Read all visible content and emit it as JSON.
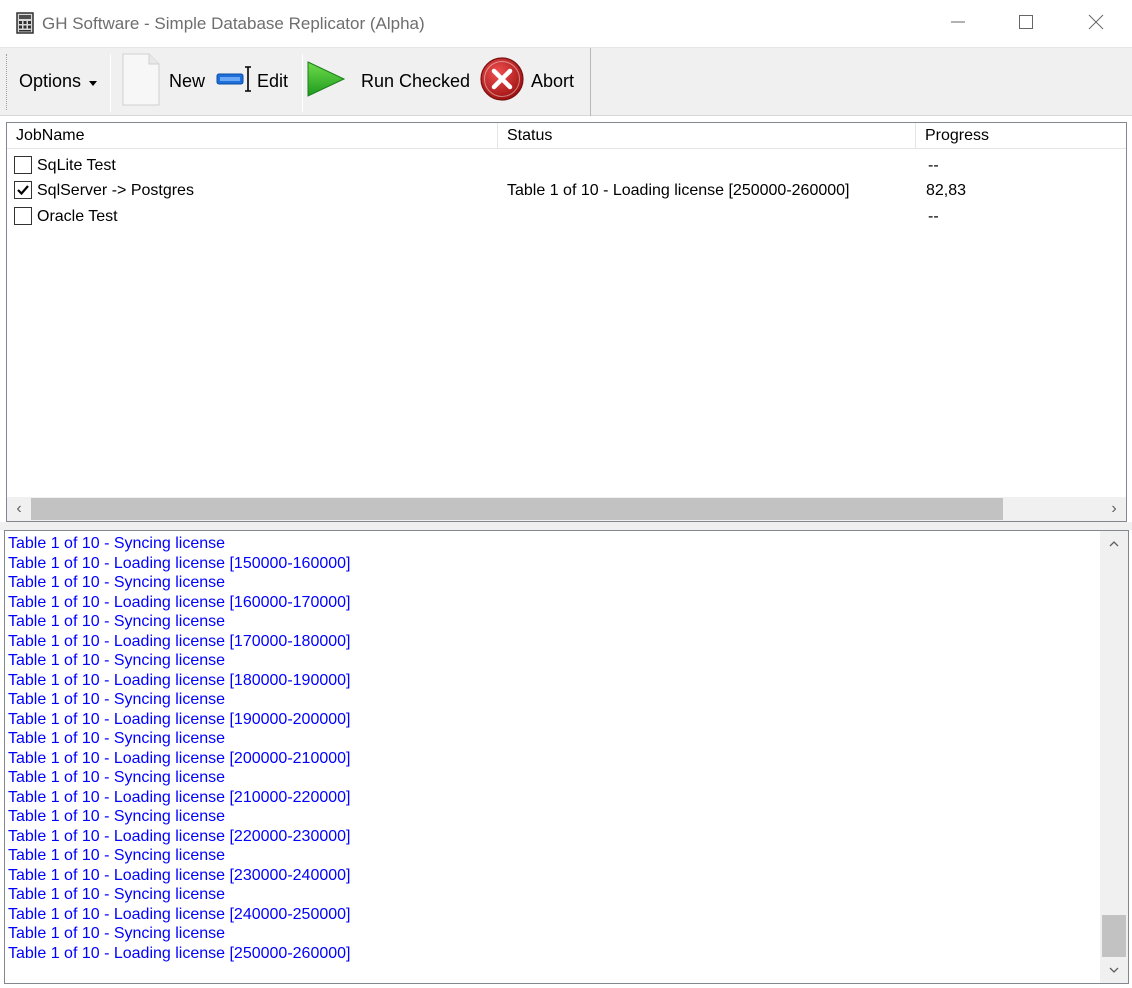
{
  "window": {
    "title": "GH Software - Simple Database Replicator (Alpha)",
    "app_icon": "database-icon",
    "controls": [
      "minimize-icon",
      "maximize-icon",
      "close-icon"
    ]
  },
  "toolbar": {
    "options_label": "Options",
    "new_label": "New",
    "edit_label": "Edit",
    "run_label": "Run Checked",
    "abort_label": "Abort"
  },
  "jobs": {
    "columns": [
      "JobName",
      "Status",
      "Progress"
    ],
    "rows": [
      {
        "name": "SqLite Test",
        "checked": false,
        "status": "",
        "progress": "--"
      },
      {
        "name": "SqlServer -> Postgres",
        "checked": true,
        "status": "Table 1 of 10 - Loading license [250000-260000]",
        "progress": "82,83"
      },
      {
        "name": "Oracle Test",
        "checked": false,
        "status": "",
        "progress": "--"
      }
    ]
  },
  "log": {
    "color": "#0000ff",
    "lines": [
      "Table 1 of 10 - Syncing license",
      "Table 1 of 10 - Loading license [150000-160000]",
      "Table 1 of 10 - Syncing license",
      "Table 1 of 10 - Loading license [160000-170000]",
      "Table 1 of 10 - Syncing license",
      "Table 1 of 10 - Loading license [170000-180000]",
      "Table 1 of 10 - Syncing license",
      "Table 1 of 10 - Loading license [180000-190000]",
      "Table 1 of 10 - Syncing license",
      "Table 1 of 10 - Loading license [190000-200000]",
      "Table 1 of 10 - Syncing license",
      "Table 1 of 10 - Loading license [200000-210000]",
      "Table 1 of 10 - Syncing license",
      "Table 1 of 10 - Loading license [210000-220000]",
      "Table 1 of 10 - Syncing license",
      "Table 1 of 10 - Loading license [220000-230000]",
      "Table 1 of 10 - Syncing license",
      "Table 1 of 10 - Loading license [230000-240000]",
      "Table 1 of 10 - Syncing license",
      "Table 1 of 10 - Loading license [240000-250000]",
      "Table 1 of 10 - Syncing license",
      "Table 1 of 10 - Loading license [250000-260000]"
    ]
  }
}
